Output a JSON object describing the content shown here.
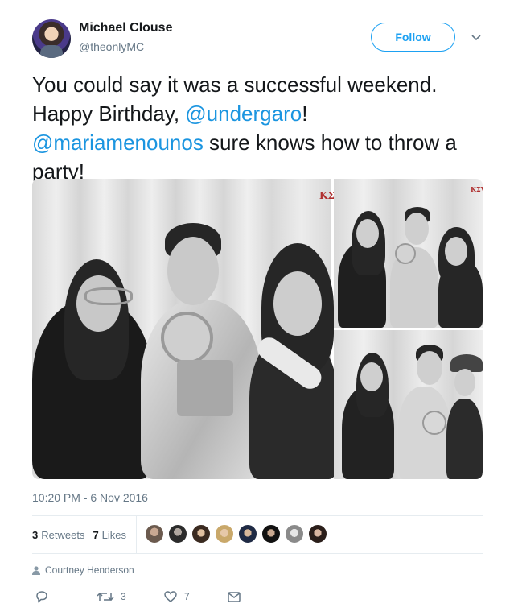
{
  "author": {
    "name": "Michael Clouse",
    "handle": "@theonlyMC"
  },
  "follow_label": "Follow",
  "tweet": {
    "line1": "You could say it was a successful weekend.",
    "line2_prefix": "Happy Birthday, ",
    "mention1": "@undergaro",
    "line2_suffix": "!",
    "mention2": "@mariamenounos",
    "line3_suffix": " sure knows how to throw a",
    "line4": "party!"
  },
  "media": {
    "logo_main": "KΣ",
    "logo_small": "KΣV"
  },
  "timestamp": "10:20 PM - 6 Nov 2016",
  "stats": {
    "retweets_count": "3",
    "retweets_label": "Retweets",
    "likes_count": "7",
    "likes_label": "Likes"
  },
  "related_user": "Courtney Henderson",
  "actions": {
    "reply_icon": "reply-icon",
    "retweet_count": "3",
    "like_count": "7",
    "dm_icon": "message-icon"
  },
  "colors": {
    "accent": "#1da1f2",
    "mention": "#1b95e0",
    "muted": "#657786"
  }
}
